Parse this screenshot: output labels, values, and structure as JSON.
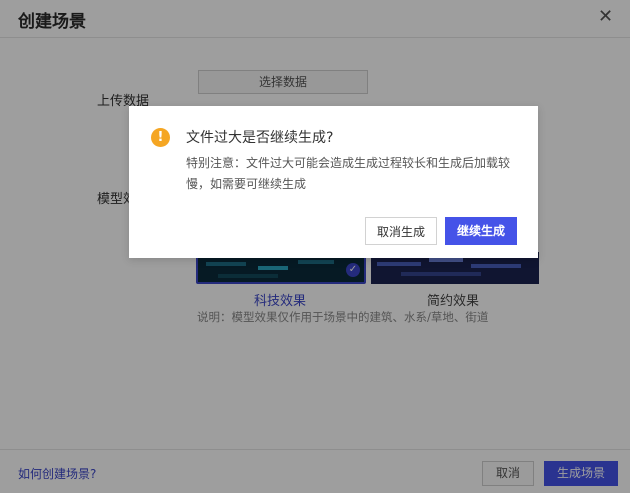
{
  "dialog": {
    "title": "创建场景",
    "close_icon": "close-icon",
    "upload_label": "上传数据",
    "select_data_button": "选择数据",
    "model_label": "模型效果",
    "effects": [
      {
        "caption": "科技效果",
        "selected": true
      },
      {
        "caption": "简约效果",
        "selected": false
      }
    ],
    "note": "说明：模型效果仅作用于场景中的建筑、水系/草地、街道",
    "help_link": "如何创建场景?",
    "cancel_button": "取消",
    "create_button": "生成场景"
  },
  "modal": {
    "icon": "warning-icon",
    "title": "文件过大是否继续生成?",
    "body": "特别注意：文件过大可能会造成生成过程较长和生成后加载较慢，如需要可继续生成",
    "cancel_button": "取消生成",
    "continue_button": "继续生成"
  },
  "colors": {
    "primary": "#4553e8",
    "warning": "#f5a623",
    "overlay": "rgba(0,0,0,0.38)"
  }
}
